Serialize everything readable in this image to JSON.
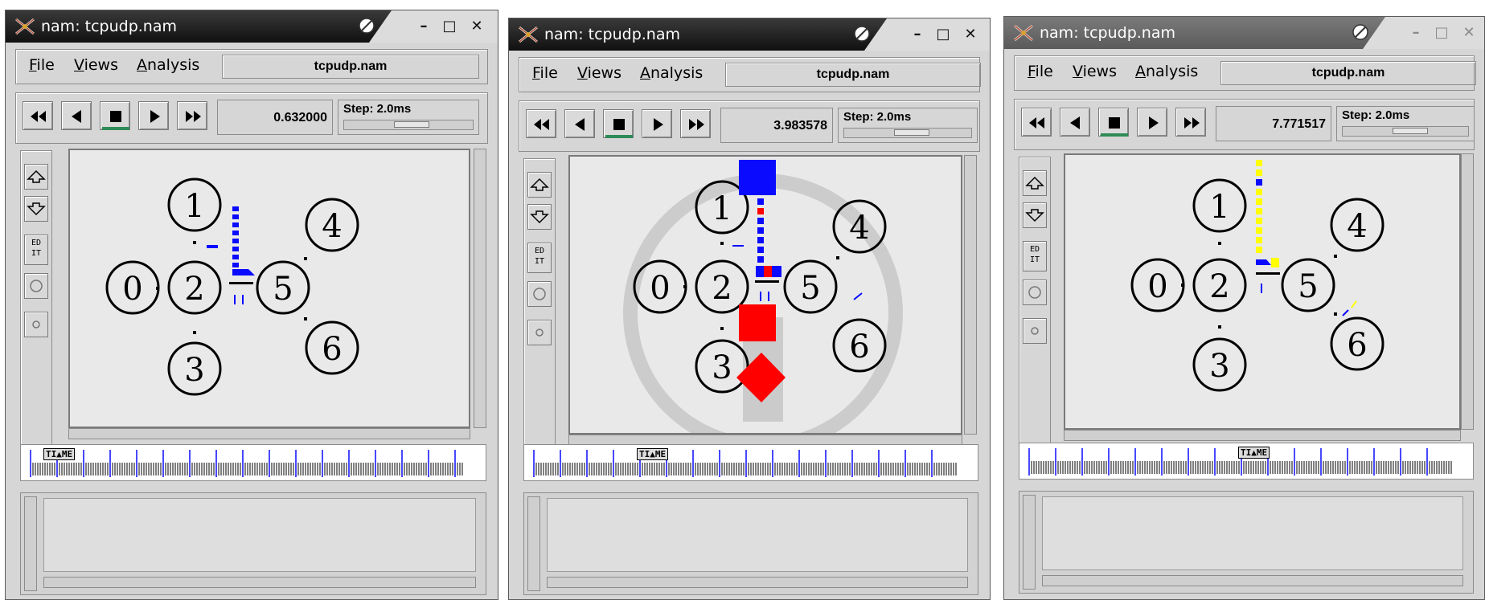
{
  "windows": [
    {
      "title": "nam: tcpudp.nam",
      "menus": [
        {
          "underline": "F",
          "rest": "ile"
        },
        {
          "underline": "V",
          "rest": "iews"
        },
        {
          "underline": "A",
          "rest": "nalysis"
        }
      ],
      "file_label": "tcpudp.nam",
      "time": "0.632000",
      "step": "Step: 2.0ms",
      "edit_label": "ED IT",
      "timeline_marker": "TI▲ME",
      "node_labels": [
        "0",
        "1",
        "2",
        "3",
        "4",
        "5",
        "6"
      ]
    },
    {
      "title": "nam: tcpudp.nam",
      "menus": [
        {
          "underline": "F",
          "rest": "ile"
        },
        {
          "underline": "V",
          "rest": "iews"
        },
        {
          "underline": "A",
          "rest": "nalysis"
        }
      ],
      "file_label": "tcpudp.nam",
      "time": "3.983578",
      "step": "Step: 2.0ms",
      "edit_label": "ED IT",
      "timeline_marker": "TI▲ME",
      "node_labels": [
        "0",
        "1",
        "2",
        "3",
        "4",
        "5",
        "6"
      ]
    },
    {
      "title": "nam: tcpudp.nam",
      "menus": [
        {
          "underline": "F",
          "rest": "ile"
        },
        {
          "underline": "V",
          "rest": "iews"
        },
        {
          "underline": "A",
          "rest": "nalysis"
        }
      ],
      "file_label": "tcpudp.nam",
      "time": "7.771517",
      "step": "Step: 2.0ms",
      "edit_label": "ED IT",
      "timeline_marker": "TI▲ME",
      "node_labels": [
        "0",
        "1",
        "2",
        "3",
        "4",
        "5",
        "6"
      ]
    }
  ],
  "colors": {
    "tcp_packet": "#0a0aff",
    "udp_packet": "#ff0000",
    "ack_packet": "#ffff00",
    "play_indicator": "#2e8b57"
  }
}
